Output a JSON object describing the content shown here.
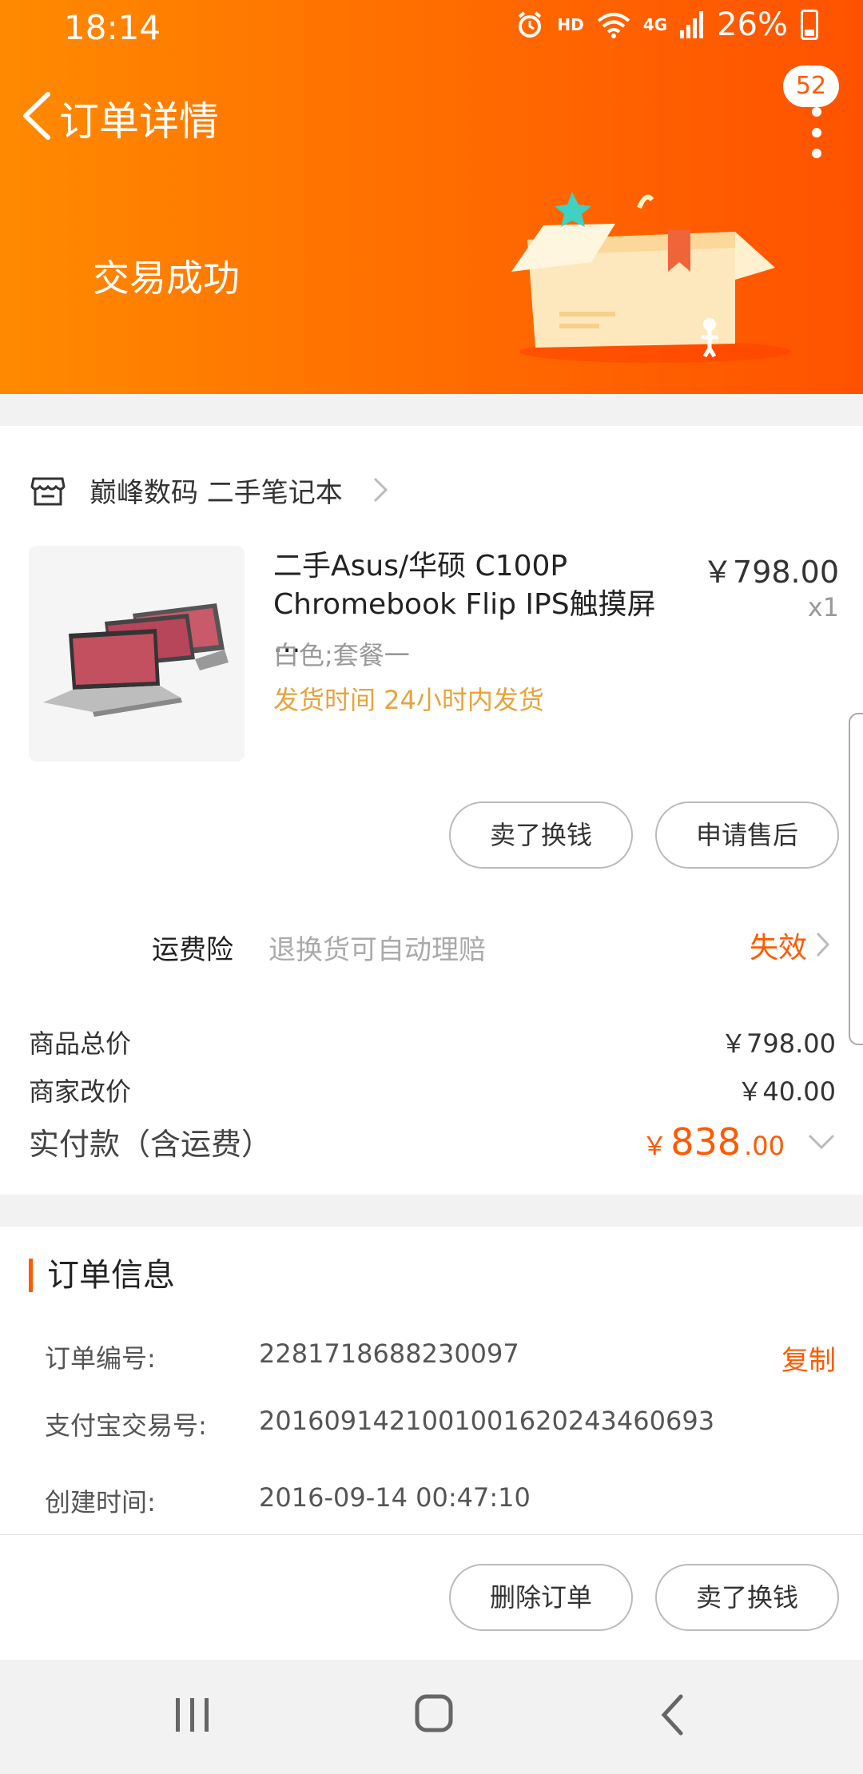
{
  "status_bar": {
    "time": "18:14",
    "hd": "HD",
    "network": "4G",
    "battery_percent": "26%"
  },
  "nav": {
    "title": "订单详情",
    "badge_count": "52"
  },
  "order_status": {
    "title": "交易成功"
  },
  "store": {
    "name": "巅峰数码 二手笔记本"
  },
  "product": {
    "title": "二手Asus/华硕 C100P Chromebook Flip IPS触摸屏 ...",
    "price": "￥798.00",
    "quantity": "x1",
    "spec": "白色;套餐一",
    "ship_time": "发货时间 24小时内发货"
  },
  "product_actions": {
    "sell_label": "卖了换钱",
    "after_sale_label": "申请售后"
  },
  "insurance": {
    "label": "运费险",
    "desc": "退换货可自动理赔",
    "status": "失效"
  },
  "summary": {
    "goods_total_label": "商品总价",
    "goods_total_value": "￥798.00",
    "merchant_adjust_label": "商家改价",
    "merchant_adjust_value": "￥40.00",
    "paid_label": "实付款（含运费）",
    "paid_currency": "￥",
    "paid_int": "838",
    "paid_dec": ".00"
  },
  "order_info": {
    "section_title": "订单信息",
    "order_no_label": "订单编号:",
    "order_no_value": "2281718688230097",
    "copy_label": "复制",
    "alipay_label": "支付宝交易号:",
    "alipay_value": "2016091421001001620243460693",
    "created_label": "创建时间:",
    "created_value": "2016-09-14 00:47:10"
  },
  "bottom_actions": {
    "delete_label": "删除订单",
    "sell_label": "卖了换钱"
  },
  "colors": {
    "accent": "#ff5a00",
    "header_start": "#ff8a00",
    "header_end": "#ff5200",
    "ship_text": "#e7a33a"
  }
}
